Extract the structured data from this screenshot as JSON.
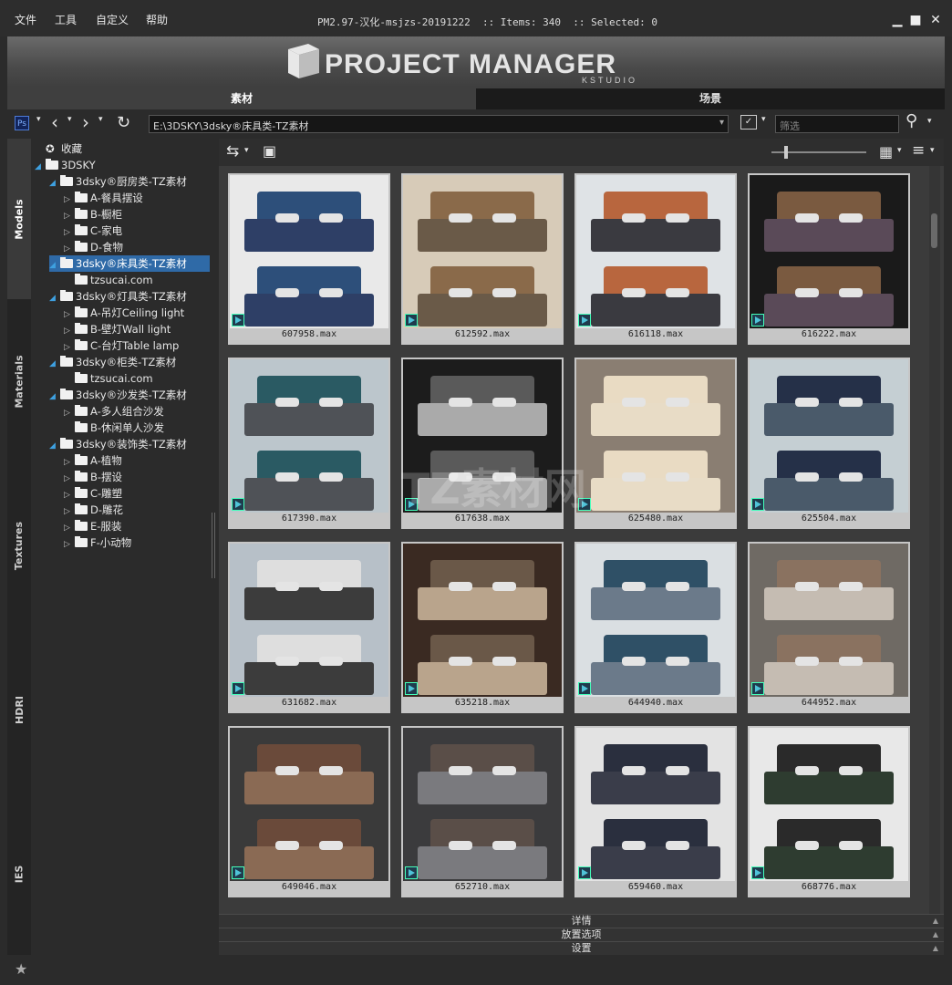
{
  "menu": [
    "文件",
    "工具",
    "自定义",
    "帮助"
  ],
  "window": {
    "title": "PM2.97-汉化-msjzs-20191222  :: Items: 340  :: Selected: 0"
  },
  "banner": {
    "logo_text": "PROJECT MANAGER",
    "logo_sub": "KSTUDIO"
  },
  "tabs": {
    "assets": "素材",
    "scenes": "场景"
  },
  "toolbar": {
    "path": "E:\\3DSKY\\3dsky®床具类-TZ素材",
    "filter_placeholder": "筛选"
  },
  "vtabs": [
    "Models",
    "Materials",
    "Textures",
    "HDRI",
    "IES"
  ],
  "tree": [
    {
      "label": "收藏",
      "level": 0,
      "kind": "star"
    },
    {
      "label": "3DSKY",
      "level": 0,
      "kind": "folder",
      "open": true
    },
    {
      "label": "3dsky®厨房类-TZ素材",
      "level": 1,
      "kind": "folder",
      "open": true
    },
    {
      "label": "A-餐具摆设",
      "level": 2,
      "kind": "folder"
    },
    {
      "label": "B-橱柜",
      "level": 2,
      "kind": "folder"
    },
    {
      "label": "C-家电",
      "level": 2,
      "kind": "folder"
    },
    {
      "label": "D-食物",
      "level": 2,
      "kind": "folder"
    },
    {
      "label": "3dsky®床具类-TZ素材",
      "level": 1,
      "kind": "folder",
      "open": true,
      "selected": true
    },
    {
      "label": "tzsucai.com",
      "level": 2,
      "kind": "folder",
      "leaf": true
    },
    {
      "label": "3dsky®灯具类-TZ素材",
      "level": 1,
      "kind": "folder",
      "open": true
    },
    {
      "label": "A-吊灯Ceiling light",
      "level": 2,
      "kind": "folder"
    },
    {
      "label": "B-壁灯Wall light",
      "level": 2,
      "kind": "folder"
    },
    {
      "label": "C-台灯Table lamp",
      "level": 2,
      "kind": "folder"
    },
    {
      "label": "3dsky®柜类-TZ素材",
      "level": 1,
      "kind": "folder",
      "open": true
    },
    {
      "label": "tzsucai.com",
      "level": 2,
      "kind": "folder",
      "leaf": true
    },
    {
      "label": "3dsky®沙发类-TZ素材",
      "level": 1,
      "kind": "folder",
      "open": true
    },
    {
      "label": "A-多人组合沙发",
      "level": 2,
      "kind": "folder"
    },
    {
      "label": "B-休闲单人沙发",
      "level": 2,
      "kind": "folder",
      "leaf": true
    },
    {
      "label": "3dsky®装饰类-TZ素材",
      "level": 1,
      "kind": "folder",
      "open": true
    },
    {
      "label": "A-植物",
      "level": 2,
      "kind": "folder"
    },
    {
      "label": "B-摆设",
      "level": 2,
      "kind": "folder"
    },
    {
      "label": "C-雕塑",
      "level": 2,
      "kind": "folder"
    },
    {
      "label": "D-雕花",
      "level": 2,
      "kind": "folder"
    },
    {
      "label": "E-服装",
      "level": 2,
      "kind": "folder"
    },
    {
      "label": "F-小动物",
      "level": 2,
      "kind": "folder"
    }
  ],
  "items": [
    {
      "file": "607958.max",
      "bg": "#e9e9e9",
      "bed": "#2e3f66",
      "hb": "#2d4f7a"
    },
    {
      "file": "612592.max",
      "bg": "#d7cbb8",
      "bed": "#6a5a48",
      "hb": "#8a6a4a"
    },
    {
      "file": "616118.max",
      "bg": "#dfe3e6",
      "bed": "#3a3a40",
      "hb": "#b8663e"
    },
    {
      "file": "616222.max",
      "bg": "#1a1a1a",
      "bed": "#5a4a58",
      "hb": "#7a5a40"
    },
    {
      "file": "617390.max",
      "bg": "#bcc6cc",
      "bed": "#4f5257",
      "hb": "#2a5a63"
    },
    {
      "file": "617638.max",
      "bg": "#1c1c1c",
      "bed": "#aaaaaa",
      "hb": "#5a5a5a"
    },
    {
      "file": "625480.max",
      "bg": "#8a7e72",
      "bed": "#e8dcc6",
      "hb": "#e9dbc3"
    },
    {
      "file": "625504.max",
      "bg": "#c5cfd3",
      "bed": "#4a5a6a",
      "hb": "#253048"
    },
    {
      "file": "631682.max",
      "bg": "#b7c0c8",
      "bed": "#3c3c3c",
      "hb": "#dedede"
    },
    {
      "file": "635218.max",
      "bg": "#3a2a22",
      "bed": "#b9a48c",
      "hb": "#6a5848"
    },
    {
      "file": "644940.max",
      "bg": "#dadfe2",
      "bed": "#6b7a8a",
      "hb": "#2f5066"
    },
    {
      "file": "644952.max",
      "bg": "#6f6a64",
      "bed": "#c5bcb2",
      "hb": "#8a7260"
    },
    {
      "file": "649046.max",
      "bg": "#3a3a3a",
      "bed": "#8a6a54",
      "hb": "#6a4a3a"
    },
    {
      "file": "652710.max",
      "bg": "#3b3b3d",
      "bed": "#7a7a7e",
      "hb": "#5a4e48"
    },
    {
      "file": "659460.max",
      "bg": "#e3e3e3",
      "bed": "#3a3d4a",
      "hb": "#2a2f3e"
    },
    {
      "file": "668776.max",
      "bg": "#e8e8e8",
      "bed": "#2e3c30",
      "hb": "#2a2a2a"
    }
  ],
  "panels": {
    "details": "详情",
    "placement": "放置选项",
    "settings": "设置"
  },
  "watermark": "TZ素材网"
}
